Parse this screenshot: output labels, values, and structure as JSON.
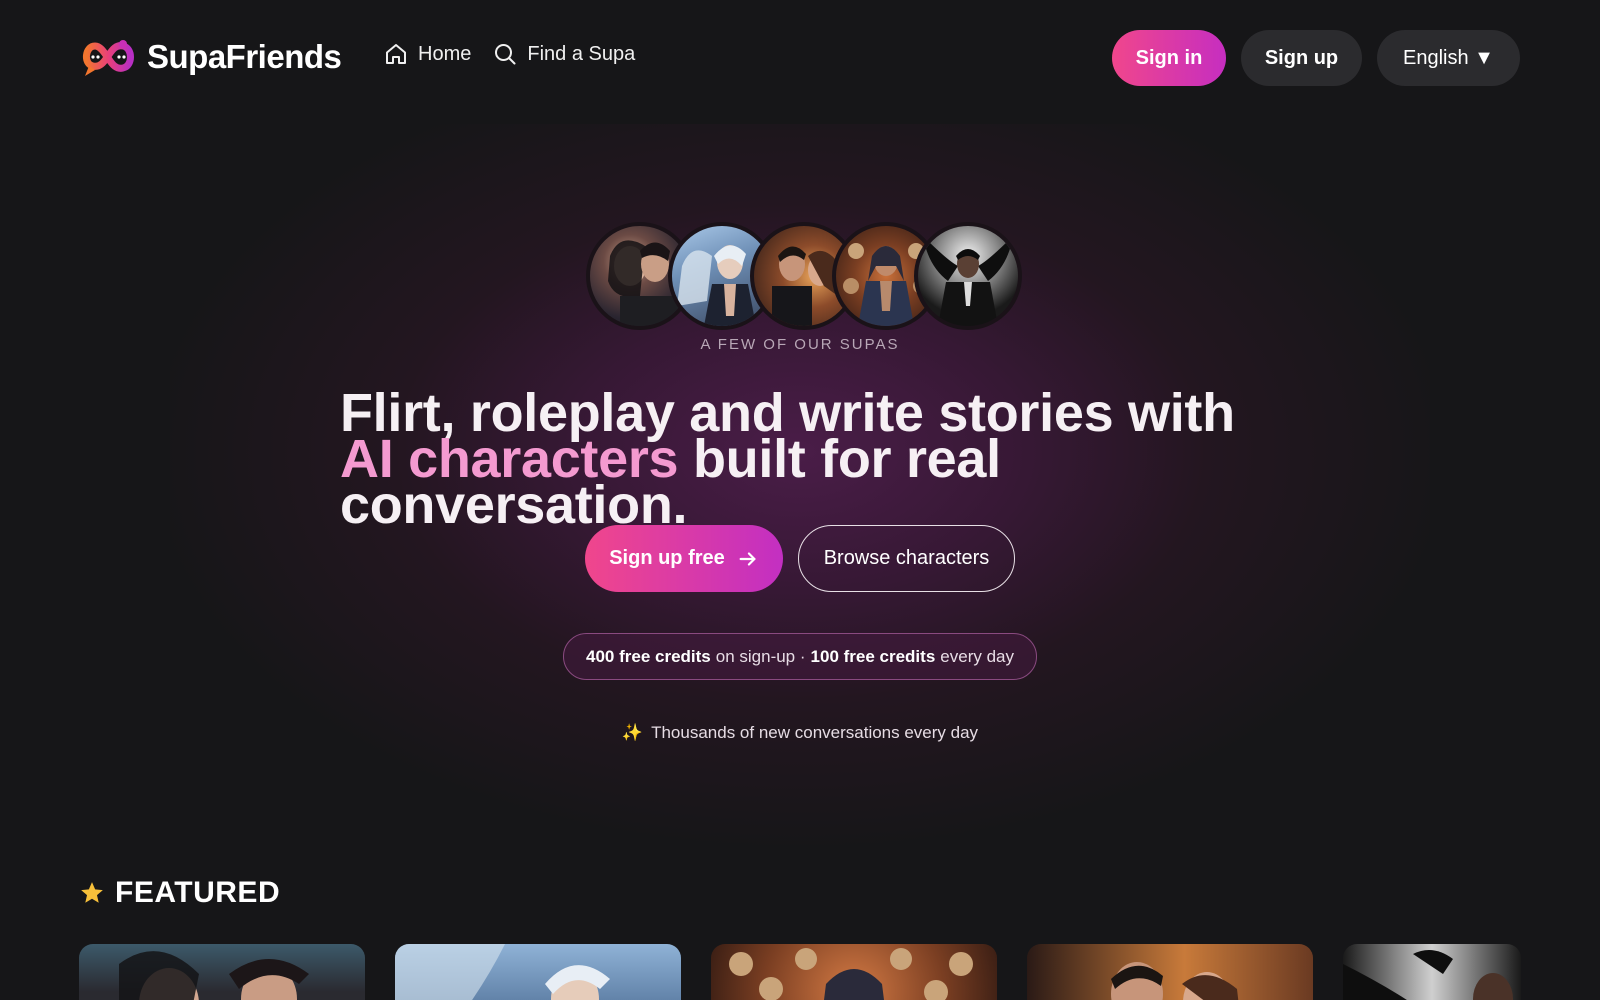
{
  "brand": {
    "name": "SupaFriends"
  },
  "nav": {
    "home": "Home",
    "find": "Find a Supa"
  },
  "header": {
    "signin": "Sign in",
    "signup": "Sign up",
    "language": "English ▼"
  },
  "hero": {
    "avatars_caption": "A FEW OF OUR SUPAS",
    "headline_part1": "Flirt, roleplay and write stories with ",
    "headline_highlight": "AI characters",
    "headline_part2": " built for real conversation.",
    "cta_primary": "Sign up free",
    "cta_secondary": "Browse characters",
    "credits_bold1": "400 free credits",
    "credits_text1": "on sign-up ·",
    "credits_bold2": "100 free credits",
    "credits_text2": "every day",
    "tagline_icon": "✨",
    "tagline": "Thousands of new conversations every day"
  },
  "featured": {
    "title": "FEATURED"
  },
  "colors": {
    "accent_pink": "#f0468c",
    "accent_purple": "#c62ec0",
    "highlight_text": "#f49ad0",
    "background": "#161618"
  }
}
